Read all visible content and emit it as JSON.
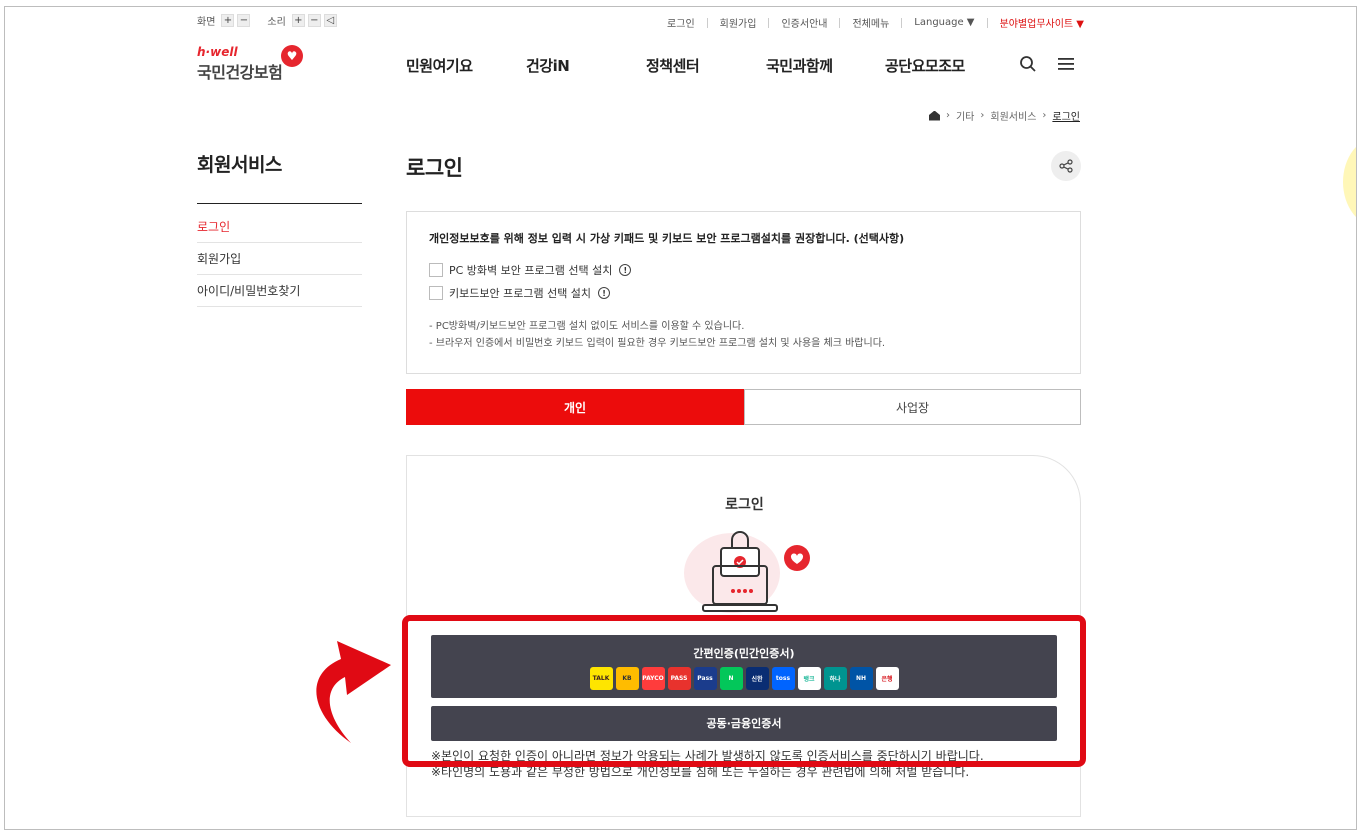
{
  "utility": {
    "screen_label": "화면",
    "sound_label": "소리",
    "plus": "+",
    "minus": "−"
  },
  "toplinks": {
    "login": "로그인",
    "signup": "회원가입",
    "cert_guide": "인증서안내",
    "all_menu": "전체메뉴",
    "language": "Language ▼",
    "sites": "분야별업무사이트 ▼"
  },
  "logo": {
    "small": "h·well",
    "main": "국민건강보험"
  },
  "gnb": [
    "민원여기요",
    "건강iN",
    "정책센터",
    "국민과함께",
    "공단요모조모"
  ],
  "breadcrumb": [
    "기타",
    "회원서비스",
    "로그인"
  ],
  "sidebar": {
    "title": "회원서비스",
    "items": [
      "로그인",
      "회원가입",
      "아이디/비밀번호찾기"
    ]
  },
  "page_title": "로그인",
  "notice": {
    "head": "개인정보보호를 위해 정보 입력 시 가상 키패드 및 키보드 보안 프로그램설치를 권장합니다. (선택사항)",
    "checks": [
      "PC 방화벽 보안 프로그램 선택 설치",
      "키보드보안 프로그램 선택 설치"
    ],
    "notes": [
      "- PC방화벽/키보드보안 프로그램 설치 없이도 서비스를 이용할 수 있습니다.",
      "- 브라우저 인증에서 비밀번호 키보드 입력이 필요한 경우 키보드보안 프로그램 설치 및 사용을 체크 바랍니다."
    ]
  },
  "tabs": [
    "개인",
    "사업장"
  ],
  "login_box": {
    "title": "로그인",
    "simple_auth": "간편인증(민간인증서)",
    "public_cert": "공동·금융인증서",
    "warnings": [
      "※본인이 요청한 인증이 아니라면 정보가 악용되는 사례가 발생하지 않도록 인증서비스를 중단하시기 바랍니다.",
      "※타인명의 도용과 같은 부정한 방법으로 개인정보를 침해 또는 누설하는 경우 관련법에 의해 처벌 받습니다."
    ]
  },
  "providers": [
    {
      "label": "TALK",
      "bg": "#fee500",
      "fg": "#3b1e1e"
    },
    {
      "label": "KB",
      "bg": "#ffbc00",
      "fg": "#333333"
    },
    {
      "label": "PAYCO",
      "bg": "#ff3c3c",
      "fg": "#ffffff"
    },
    {
      "label": "PASS",
      "bg": "#e8322d",
      "fg": "#ffffff"
    },
    {
      "label": "Pass",
      "bg": "#1b3c8c",
      "fg": "#ffffff"
    },
    {
      "label": "N",
      "bg": "#03c75a",
      "fg": "#ffffff"
    },
    {
      "label": "신한",
      "bg": "#0a2d73",
      "fg": "#ffffff"
    },
    {
      "label": "toss",
      "bg": "#0064ff",
      "fg": "#ffffff"
    },
    {
      "label": "뱅크",
      "bg": "#ffffff",
      "fg": "#1fb89a"
    },
    {
      "label": "하나",
      "bg": "#009490",
      "fg": "#ffffff"
    },
    {
      "label": "NH",
      "bg": "#0054a6",
      "fg": "#ffffff"
    },
    {
      "label": "은행",
      "bg": "#ffffff",
      "fg": "#d71920"
    }
  ],
  "colors": {
    "accent": "#ec0c0c",
    "dark_button": "#44444f",
    "highlight": "#e00a14"
  }
}
